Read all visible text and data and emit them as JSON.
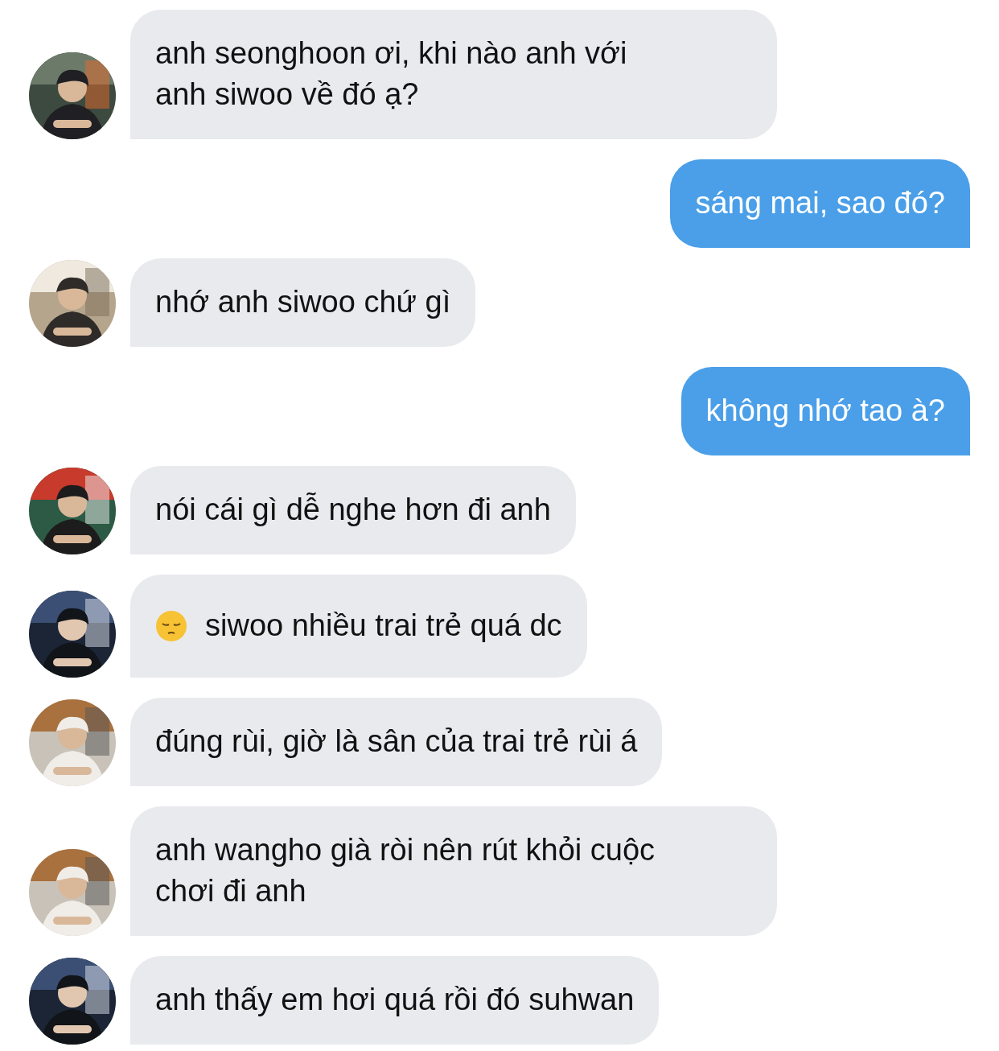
{
  "messages": [
    {
      "kind": "incoming",
      "text": "anh seonghoon ơi, khi nào anh với\nanh siwoo về đó ạ?"
    },
    {
      "kind": "outgoing",
      "text": "sáng mai, sao đó?"
    },
    {
      "kind": "incoming",
      "text": "nhớ anh siwoo chứ gì"
    },
    {
      "kind": "outgoing",
      "text": "không nhớ tao à?"
    },
    {
      "kind": "incoming",
      "text": "nói cái gì dễ nghe hơn đi anh"
    },
    {
      "kind": "incoming",
      "text": "siwoo nhiều trai trẻ quá dc",
      "leading_emoji": true
    },
    {
      "kind": "incoming",
      "text": "đúng rùi, giờ là sân của trai trẻ rùi á"
    },
    {
      "kind": "incoming",
      "text": "anh wangho già ròi nên rút khỏi cuộc\nchơi đi anh"
    },
    {
      "kind": "incoming",
      "text": "anh thấy em hơi quá rồi đó suhwan"
    }
  ]
}
